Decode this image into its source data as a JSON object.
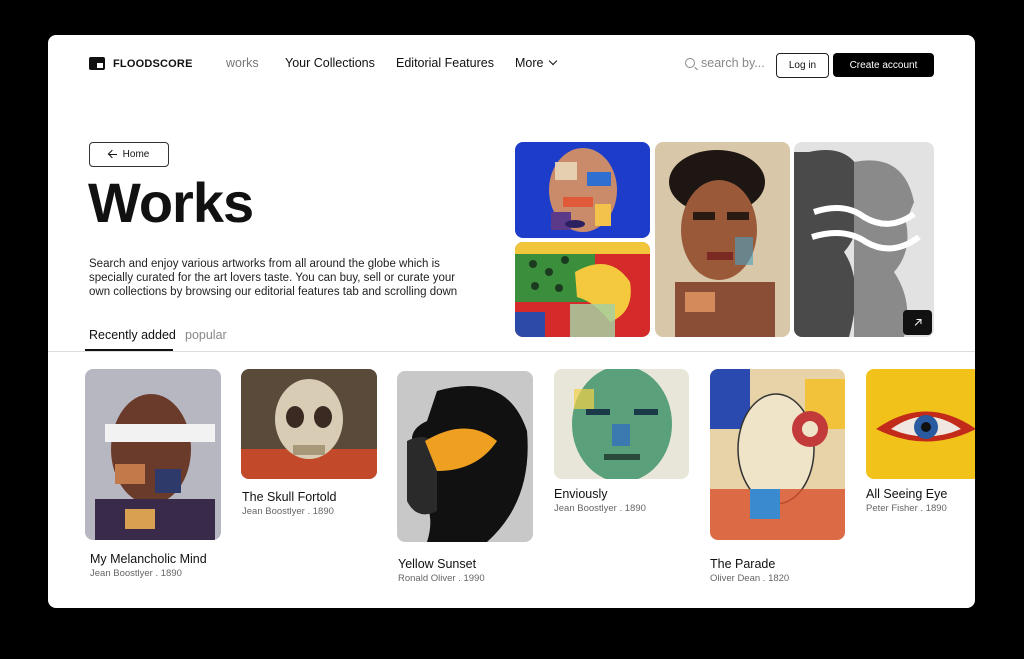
{
  "brand": {
    "name": "FLOODSCORE"
  },
  "nav": {
    "items": [
      {
        "label": "works"
      },
      {
        "label": "Your Collections"
      },
      {
        "label": "Editorial Features"
      },
      {
        "label": "More"
      }
    ]
  },
  "search": {
    "placeholder": "search by..."
  },
  "auth": {
    "login_label": "Log in",
    "create_label": "Create account"
  },
  "page": {
    "home_label": "Home",
    "title": "Works",
    "description": "Search and enjoy various artworks from all around the globe which is specially curated for the art lovers taste. You can buy, sell or curate your own collections by browsing our editorial features tab and scrolling down"
  },
  "tabs": [
    {
      "label": "Recently added",
      "active": true
    },
    {
      "label": "popular",
      "active": false
    }
  ],
  "colors": {
    "accent": "#000000",
    "muted": "#888888"
  },
  "artworks": [
    {
      "title": "My Melancholic Mind",
      "artist": "Jean Boostlyer",
      "year": "1890",
      "meta": "Jean Boostlyer . 1890"
    },
    {
      "title": "The Skull Fortold",
      "artist": "Jean Boostlyer",
      "year": "1890",
      "meta": "Jean Boostlyer . 1890"
    },
    {
      "title": "Yellow Sunset",
      "artist": "Ronald Oliver",
      "year": "1990",
      "meta": "Ronald Oliver . 1990"
    },
    {
      "title": "Enviously",
      "artist": "Jean Boostlyer",
      "year": "1890",
      "meta": "Jean Boostlyer . 1890"
    },
    {
      "title": "The Parade",
      "artist": "Oliver Dean",
      "year": "1820",
      "meta": "Oliver Dean . 1820"
    },
    {
      "title": "All Seeing Eye",
      "artist": "Peter Fisher",
      "year": "1890",
      "meta": "Peter Fisher . 1890"
    }
  ]
}
